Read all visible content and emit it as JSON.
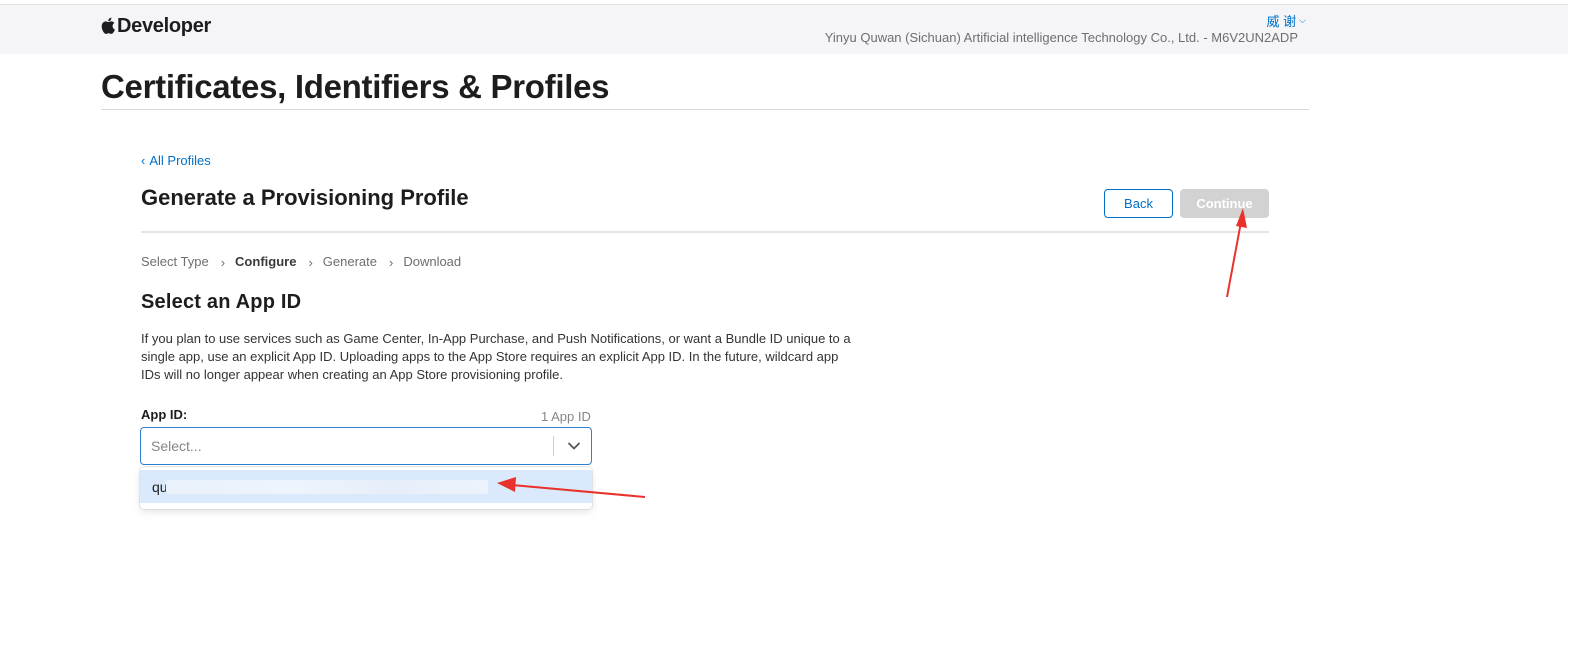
{
  "header": {
    "brand": "Developer",
    "user": "威 谢",
    "team": "Yinyu Quwan (Sichuan) Artificial intelligence Technology Co., Ltd. - M6V2UN2ADP"
  },
  "page_title": "Certificates, Identifiers & Profiles",
  "back_link": "All Profiles",
  "section_title": "Generate a Provisioning Profile",
  "buttons": {
    "back": "Back",
    "continue": "Continue"
  },
  "steps": [
    "Select Type",
    "Configure",
    "Generate",
    "Download"
  ],
  "active_step": "Configure",
  "subsection_title": "Select an App ID",
  "description": "If you plan to use services such as Game Center, In-App Purchase, and Push Notifications, or want a Bundle ID unique to a single app, use an explicit App ID. Uploading apps to the App Store requires an explicit App ID. In the future, wildcard app IDs will no longer appear when creating an App Store provisioning profile.",
  "app_id_field": {
    "label": "App ID:",
    "count": "1 App ID",
    "placeholder": "Select...",
    "options": [
      {
        "label": "qu",
        "redacted": true
      }
    ]
  },
  "colors": {
    "accent": "#0070c9",
    "continue_disabled": "#d2d2d2",
    "option_highlight": "#dae9fb",
    "annotation_arrow": "#e8322b"
  },
  "icons": {
    "brand_logo": "apple-logo-icon",
    "user_menu": "chevron-down-icon",
    "back_link": "chevron-left-icon",
    "step_separator": "chevron-right-icon",
    "select": "chevron-down-icon"
  }
}
